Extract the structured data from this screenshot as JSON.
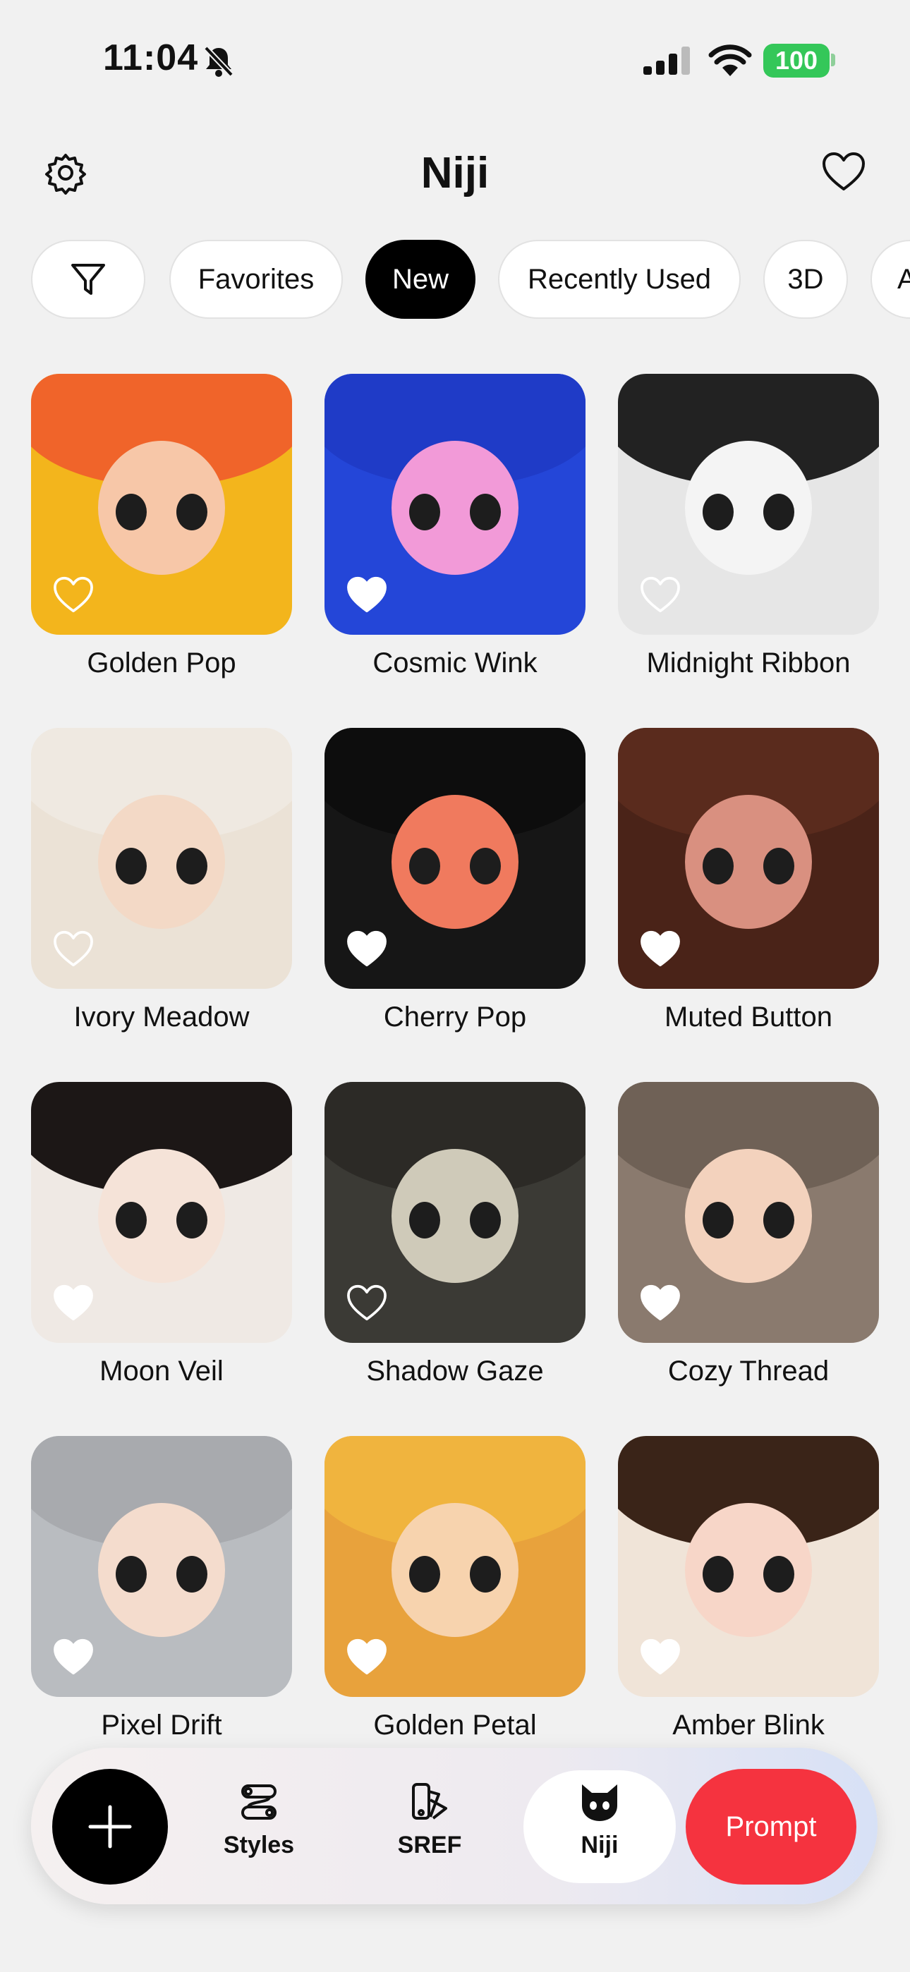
{
  "status_bar": {
    "time": "11:04",
    "battery": "100"
  },
  "header": {
    "title": "Niji"
  },
  "chips": [
    {
      "label": "",
      "icon": "filter-icon"
    },
    {
      "label": "Favorites"
    },
    {
      "label": "New",
      "active": true
    },
    {
      "label": "Recently Used"
    },
    {
      "label": "3D"
    },
    {
      "label": "A"
    }
  ],
  "styles": [
    {
      "name": "Golden Pop",
      "favorited": false,
      "bg": "#f3b51c",
      "hair": "#f0642a",
      "face": "#f7c7a8"
    },
    {
      "name": "Cosmic Wink",
      "favorited": true,
      "bg": "#2446d8",
      "hair": "#1f3bc7",
      "face": "#f29ad8"
    },
    {
      "name": "Midnight Ribbon",
      "favorited": false,
      "bg": "#e6e6e6",
      "hair": "#222222",
      "face": "#f4f4f4"
    },
    {
      "name": "Ivory Meadow",
      "favorited": false,
      "bg": "#ebe2d6",
      "hair": "#efe9e1",
      "face": "#f3d9c6"
    },
    {
      "name": "Cherry Pop",
      "favorited": true,
      "bg": "#161616",
      "hair": "#0d0d0d",
      "face": "#f07a5e"
    },
    {
      "name": "Muted Button",
      "favorited": true,
      "bg": "#4a2318",
      "hair": "#5a2b1d",
      "face": "#d99080"
    },
    {
      "name": "Moon Veil",
      "favorited": true,
      "bg": "#efe9e4",
      "hair": "#1c1716",
      "face": "#f5e3d8"
    },
    {
      "name": "Shadow Gaze",
      "favorited": false,
      "bg": "#3b3a35",
      "hair": "#2c2a26",
      "face": "#cfcab9"
    },
    {
      "name": "Cozy Thread",
      "favorited": true,
      "bg": "#8a7a6e",
      "hair": "#6f6156",
      "face": "#f3d2bd"
    },
    {
      "name": "Pixel Drift",
      "favorited": true,
      "bg": "#b9bcc0",
      "hair": "#a8aaae",
      "face": "#f4dccd"
    },
    {
      "name": "Golden Petal",
      "favorited": true,
      "bg": "#e8a23c",
      "hair": "#f0b43e",
      "face": "#f7d3ae"
    },
    {
      "name": "Amber Blink",
      "favorited": true,
      "bg": "#f0e4d8",
      "hair": "#3a2418",
      "face": "#f7d6c8"
    }
  ],
  "bottom_nav": {
    "items": [
      {
        "label": "Styles",
        "icon": "styles-icon"
      },
      {
        "label": "SREF",
        "icon": "sref-icon"
      },
      {
        "label": "Niji",
        "icon": "cat-icon",
        "active": true
      }
    ],
    "prompt_label": "Prompt"
  },
  "colors": {
    "accent": "#f5333f",
    "active_chip": "#000000",
    "battery": "#34c759"
  }
}
